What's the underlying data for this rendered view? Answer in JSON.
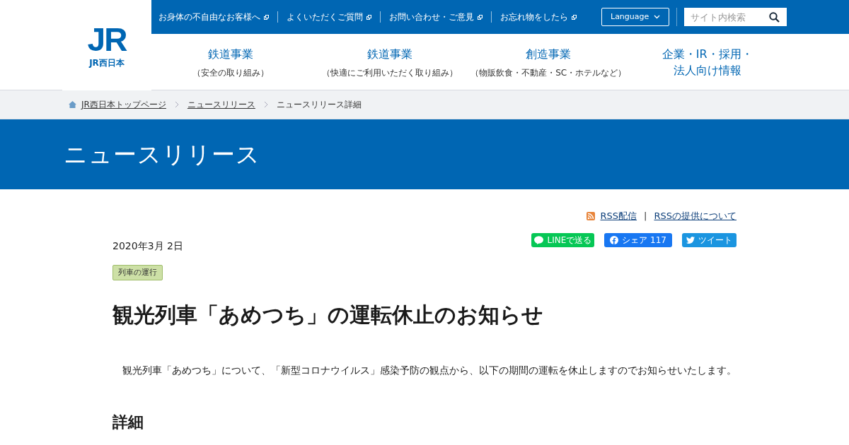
{
  "logo": {
    "mark": "JR",
    "name": "JR西日本"
  },
  "utility_links": [
    "お身体の不自由なお客様へ",
    "よくいただくご質問",
    "お問い合わせ・ご意見",
    "お忘れ物をしたら"
  ],
  "language": "Language",
  "search": {
    "placeholder": "サイト内検索"
  },
  "nav": [
    {
      "title": [
        "鉄道事業"
      ],
      "sub": "（安全の取り組み）"
    },
    {
      "title": [
        "鉄道事業"
      ],
      "sub": "（快適にご利用いただく取り組み）"
    },
    {
      "title": [
        "創造事業"
      ],
      "sub": "（物販飲食・不動産・SC・ホテルなど）"
    },
    {
      "title": [
        "企業・IR・採用・",
        "法人向け情報"
      ]
    }
  ],
  "breadcrumb": [
    {
      "label": "JR西日本トップページ",
      "link": true
    },
    {
      "label": "ニュースリリース",
      "link": true
    },
    {
      "label": "ニュースリリース詳細",
      "link": false
    }
  ],
  "page_title": "ニュースリリース",
  "rss": [
    "RSS配信",
    "RSSの提供について"
  ],
  "rss_separator": "|",
  "share": [
    {
      "kind": "line",
      "label": "LINEで送る"
    },
    {
      "kind": "facebook",
      "label": "シェア 117"
    },
    {
      "kind": "twitter",
      "label": "ツイート"
    }
  ],
  "date": "2020年3月 2日",
  "tag": "列車の運行",
  "headline": "観光列車「あめつち」の運転休止のお知らせ",
  "body": "観光列車「あめつち」について、「新型コロナウイルス」感染予防の観点から、以下の期間の運転を休止しますのでお知らせいたします。",
  "section_heading": "詳細"
}
